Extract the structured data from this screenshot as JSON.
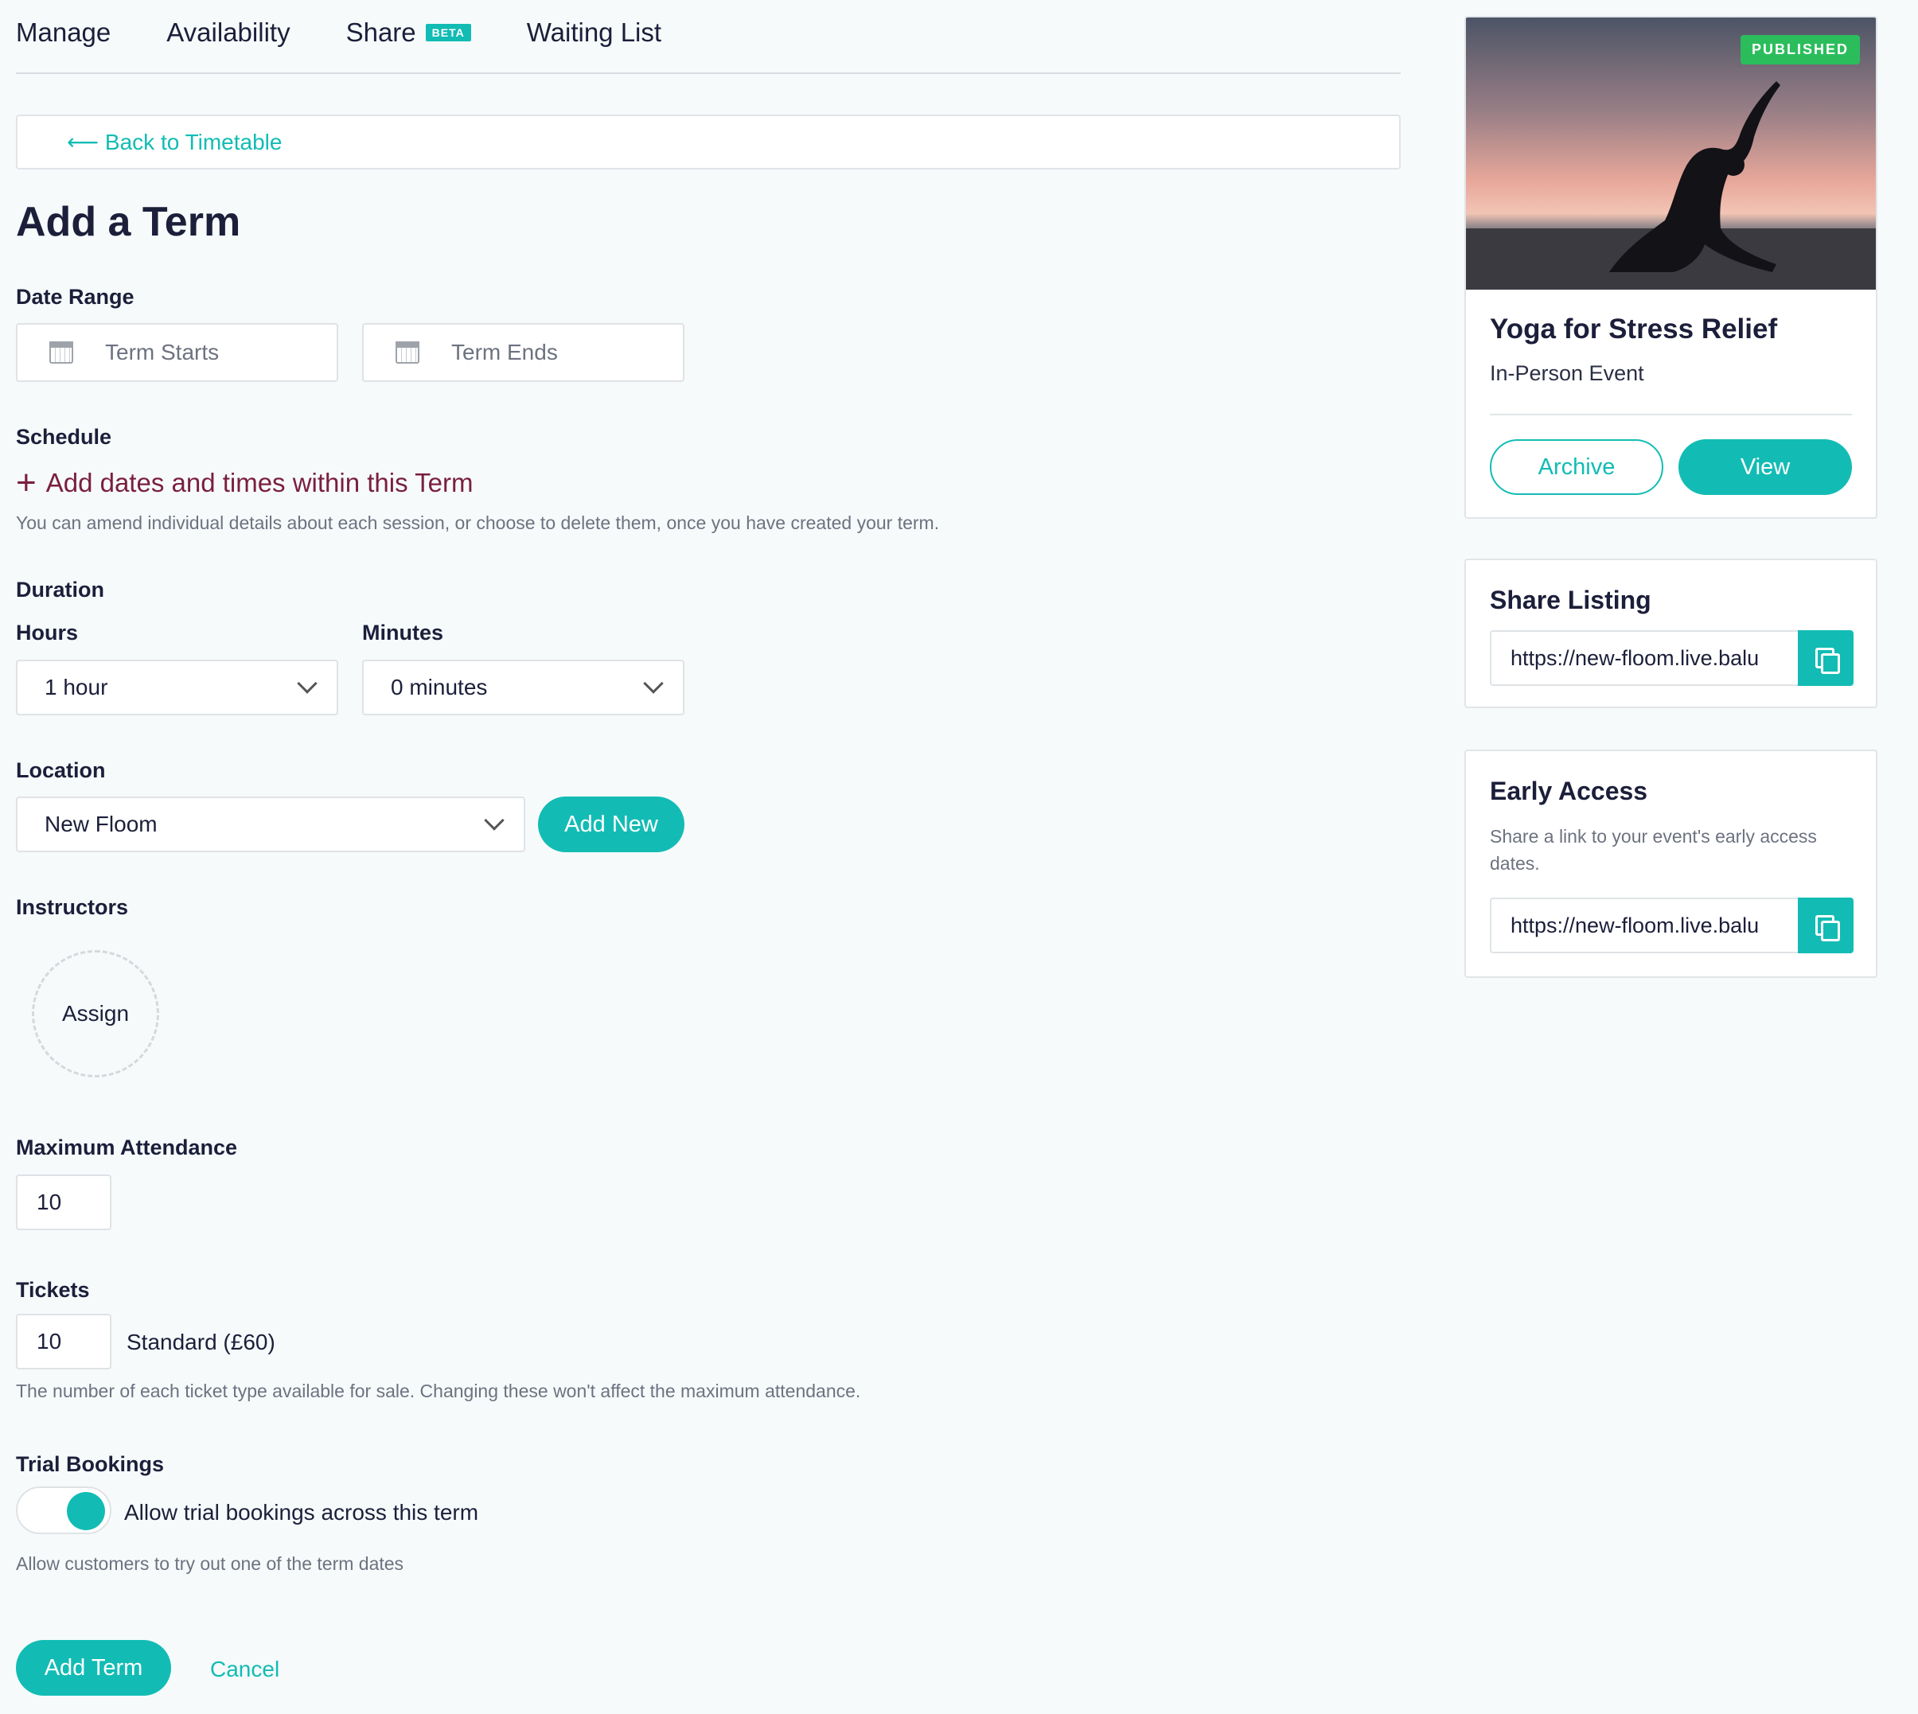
{
  "tabs": [
    {
      "label": "Manage"
    },
    {
      "label": "Availability"
    },
    {
      "label": "Share",
      "badge": "BETA"
    },
    {
      "label": "Waiting List"
    }
  ],
  "back_link": "⟵ Back to Timetable",
  "page_title": "Add a Term",
  "date_range": {
    "label": "Date Range",
    "start_placeholder": "Term Starts",
    "end_placeholder": "Term Ends"
  },
  "schedule": {
    "label": "Schedule",
    "add_link": "Add dates and times within this Term",
    "help": "You can amend individual details about each session, or choose to delete them, once you have created your term."
  },
  "duration": {
    "label": "Duration",
    "hours_label": "Hours",
    "hours_value": "1 hour",
    "minutes_label": "Minutes",
    "minutes_value": "0 minutes"
  },
  "location": {
    "label": "Location",
    "value": "New Floom",
    "add_new": "Add New"
  },
  "instructors": {
    "label": "Instructors",
    "assign": "Assign"
  },
  "max_attendance": {
    "label": "Maximum Attendance",
    "value": "10"
  },
  "tickets": {
    "label": "Tickets",
    "value": "10",
    "ticket_name": "Standard (£60)",
    "help": "The number of each ticket type available for sale. Changing these won't affect the maximum attendance."
  },
  "trial": {
    "label": "Trial Bookings",
    "toggle_label": "Allow trial bookings across this term",
    "toggle_on": true,
    "help": "Allow customers to try out one of the term dates"
  },
  "actions": {
    "submit": "Add Term",
    "cancel": "Cancel"
  },
  "event_card": {
    "status": "PUBLISHED",
    "title": "Yoga for Stress Relief",
    "type": "In-Person Event",
    "archive": "Archive",
    "view": "View"
  },
  "share_listing": {
    "title": "Share Listing",
    "url": "https://new-floom.live.balu"
  },
  "early_access": {
    "title": "Early Access",
    "description": "Share a link to your event's early access dates.",
    "url": "https://new-floom.live.balu"
  },
  "colors": {
    "accent": "#12bcb4",
    "published": "#2bbd5c",
    "schedule_link": "#7a1f3d",
    "text": "#1c1f3a"
  }
}
